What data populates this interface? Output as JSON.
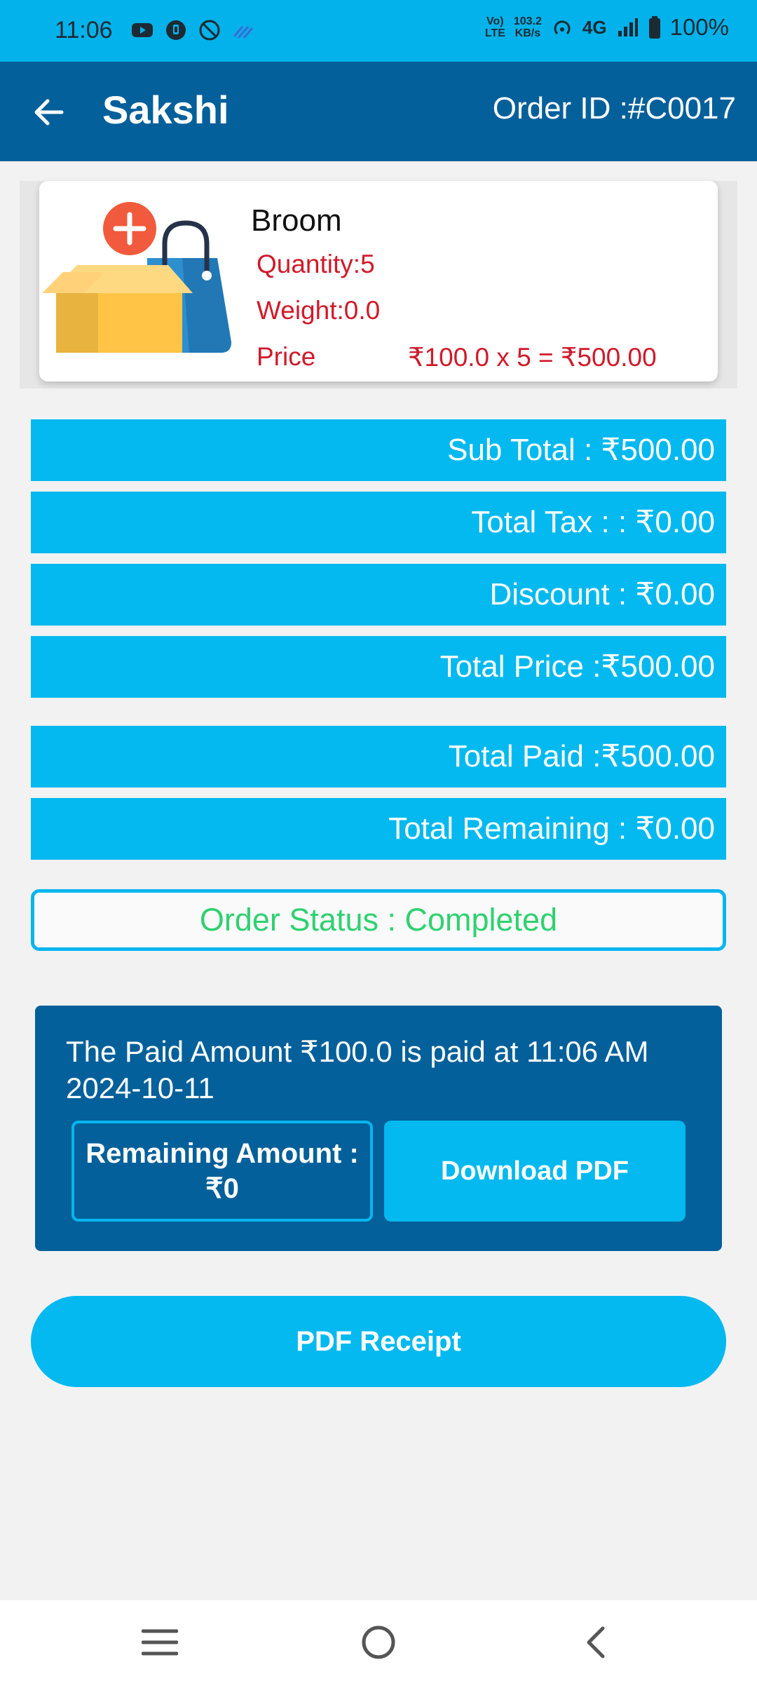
{
  "status_bar": {
    "time": "11:06",
    "volte": "Vo)\nLTE",
    "speed_top": "103.2",
    "speed_bottom": "KB/s",
    "network": "4G",
    "battery": "100%"
  },
  "app_bar": {
    "title": "Sakshi",
    "order_id": "Order ID :#C0017"
  },
  "product": {
    "name": "Broom",
    "quantity": "Quantity:5",
    "weight": "Weight:0.0",
    "price_label": "Price",
    "price_calc": "₹100.0 x 5 = ₹500.00"
  },
  "summary": {
    "sub_total": "Sub Total : ₹500.00",
    "total_tax": "Total Tax : : ₹0.00",
    "discount": "Discount : ₹0.00",
    "total_price": "Total Price :₹500.00",
    "total_paid": "Total Paid :₹500.00",
    "total_remaining": "Total Remaining : ₹0.00"
  },
  "order_status": "Order Status : Completed",
  "payment": {
    "message": "The Paid Amount ₹100.0 is paid at 11:06 AM 2024-10-11",
    "remaining_label": "Remaining Amount :",
    "remaining_value": "₹0",
    "download_label": "Download PDF"
  },
  "receipt_button": "PDF Receipt",
  "colors": {
    "primary_dark": "#04609a",
    "accent": "#03b9ef",
    "status_green": "#2fd170",
    "price_red": "#d01a2a"
  },
  "icons": {
    "back": "arrow-left-icon",
    "product": "add-box-bag-icon",
    "nav_menu": "menu-icon",
    "nav_home": "home-circle-icon",
    "nav_back": "chevron-left-icon"
  }
}
